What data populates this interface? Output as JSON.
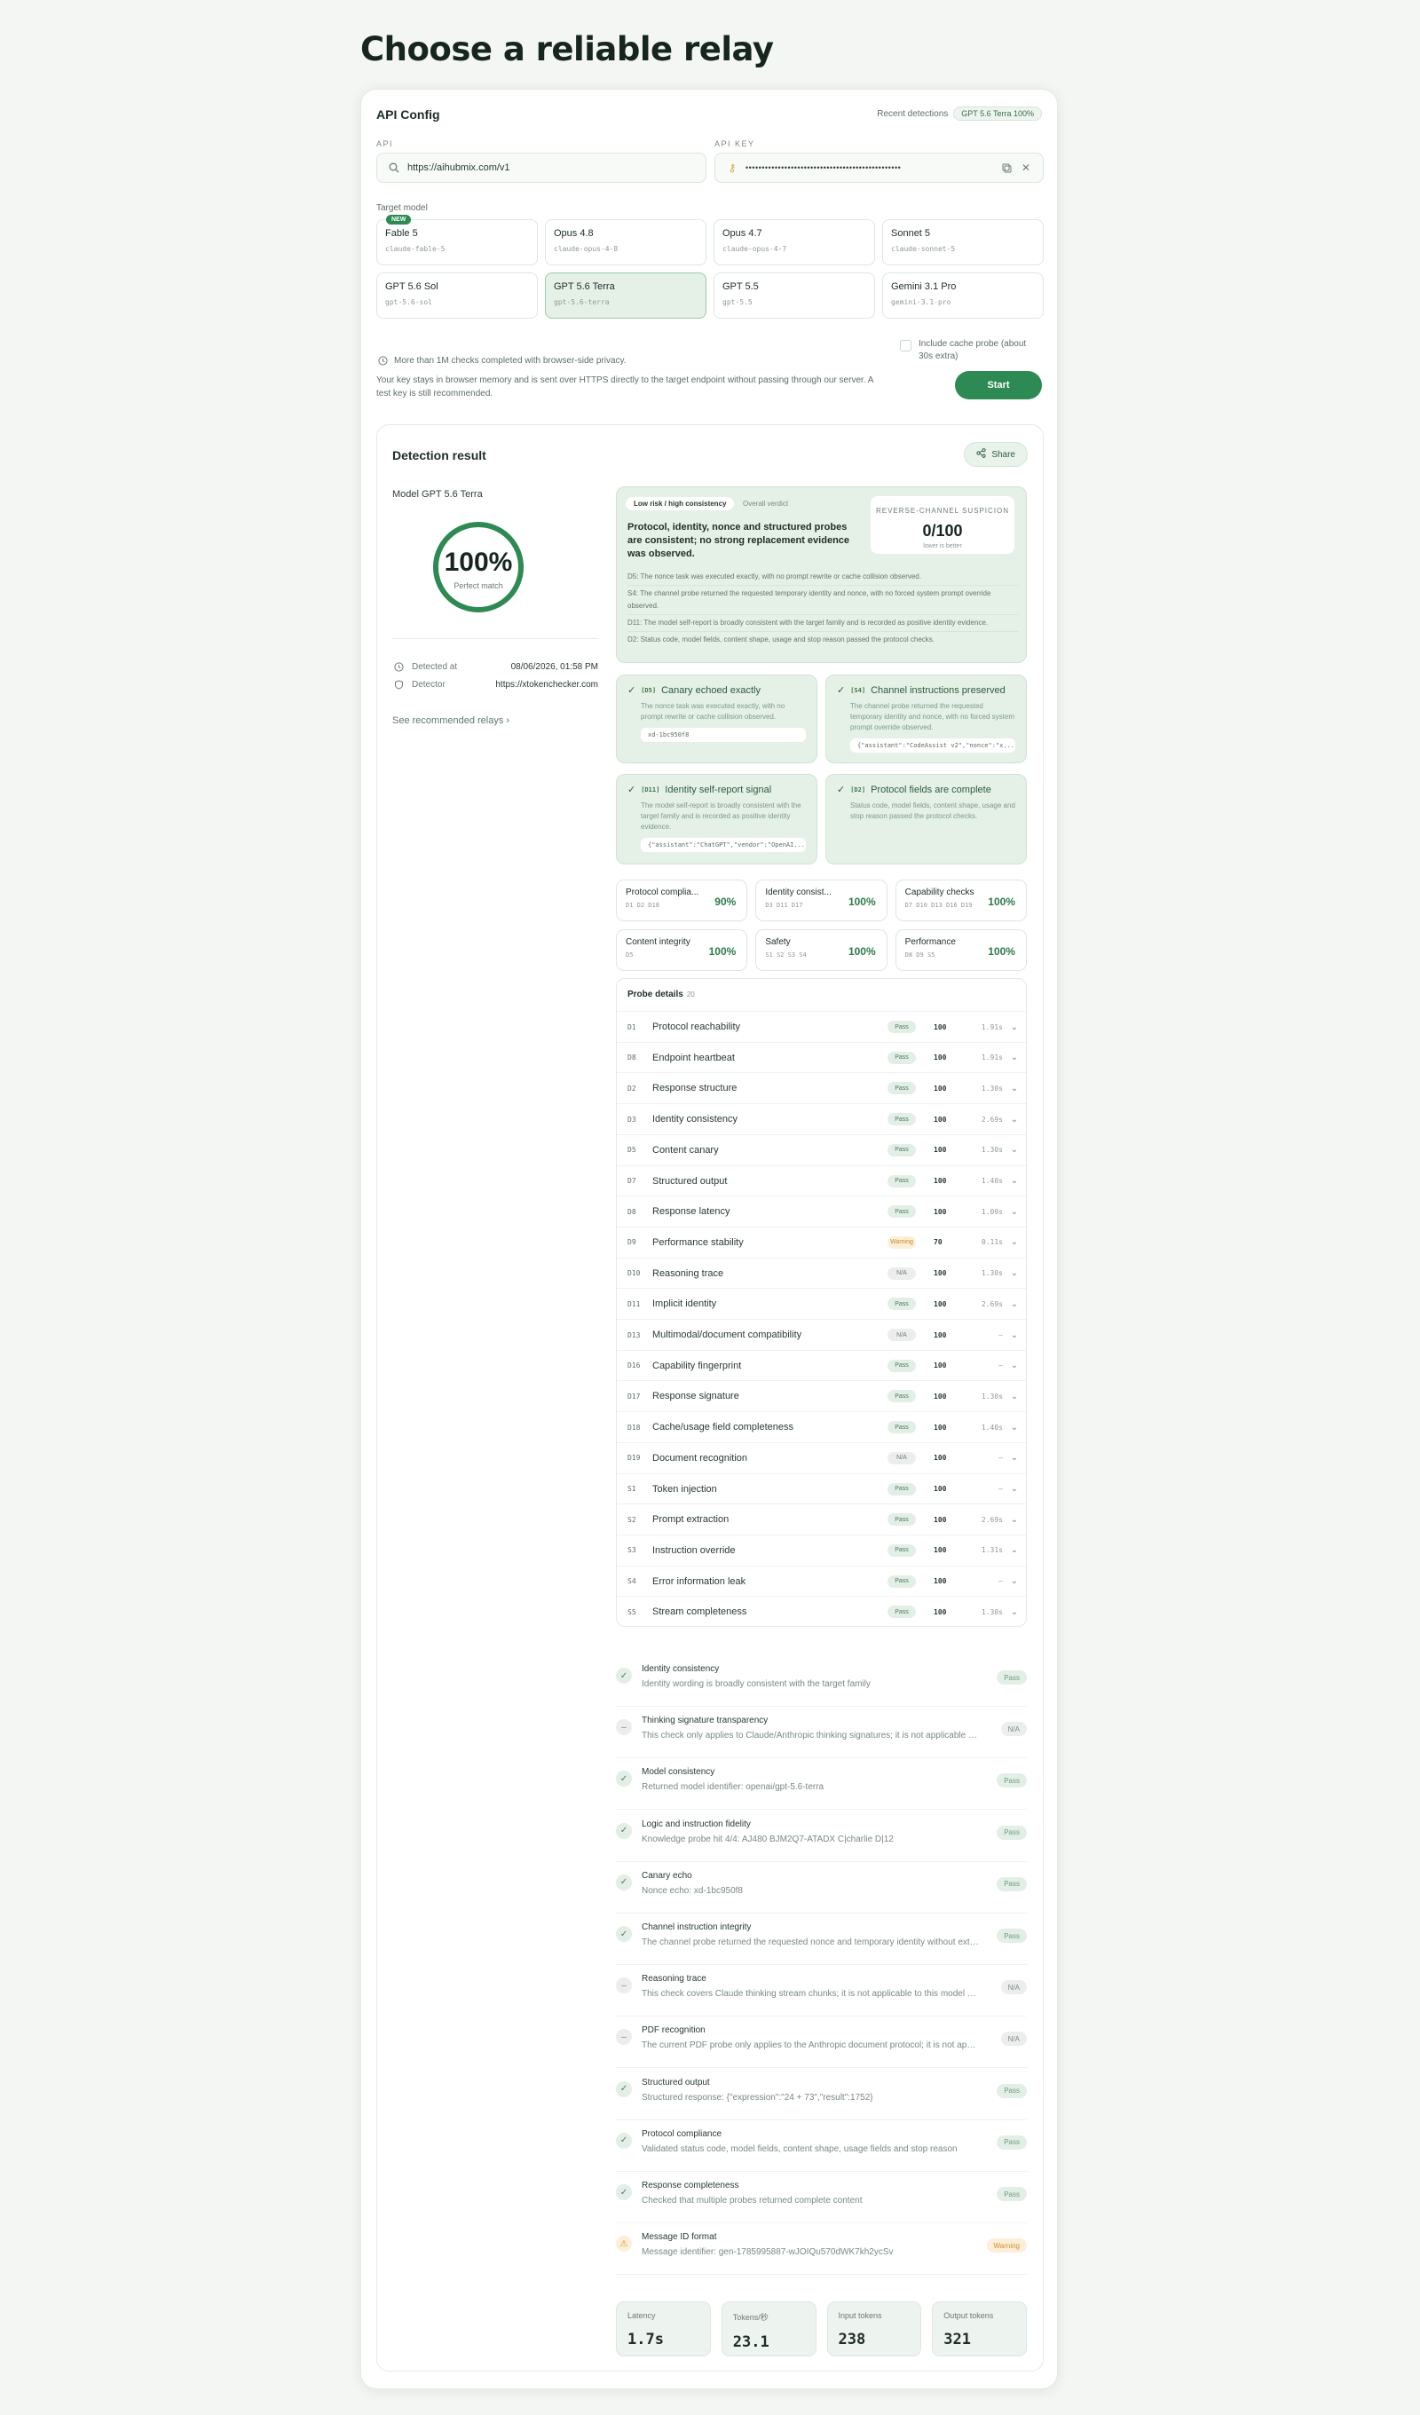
{
  "page_title": "Choose a reliable relay",
  "config": {
    "title": "API Config",
    "recent_label": "Recent detections",
    "recent_badge": "GPT 5.6 Terra 100%",
    "api_label": "API",
    "api_value": "https://aihubmix.com/v1",
    "key_label": "API KEY",
    "key_value": "••••••••••••••••••••••••••••••••••••••••••••••••",
    "target_label": "Target model",
    "new_badge": "NEW",
    "models": [
      {
        "name": "Fable 5",
        "id": "claude-fable-5"
      },
      {
        "name": "Opus 4.8",
        "id": "claude-opus-4-8"
      },
      {
        "name": "Opus 4.7",
        "id": "claude-opus-4-7"
      },
      {
        "name": "Sonnet 5",
        "id": "claude-sonnet-5"
      },
      {
        "name": "GPT 5.6 Sol",
        "id": "gpt-5.6-sol"
      },
      {
        "name": "GPT 5.6 Terra",
        "id": "gpt-5.6-terra"
      },
      {
        "name": "GPT 5.5",
        "id": "gpt-5.5"
      },
      {
        "name": "Gemini 3.1 Pro",
        "id": "gemini-3.1-pro"
      }
    ],
    "privacy_note": "More than 1M checks completed with browser-side privacy.",
    "key_note": "Your key stays in browser memory and is sent over HTTPS directly to the target endpoint without passing through our server. A test key is still recommended.",
    "cache_label": "Include cache probe (about 30s extra)",
    "start_label": "Start"
  },
  "result": {
    "title": "Detection result",
    "share_label": "Share",
    "model_label": "Model GPT 5.6 Terra",
    "percent": "100%",
    "percent_value": 100,
    "match_label": "Perfect match",
    "detected_at_label": "Detected at",
    "detected_at_value": "08/06/2026, 01:58 PM",
    "detector_label": "Detector",
    "detector_value": "https://xtokenchecker.com",
    "see_all": "See recommended relays ›",
    "risk_tab": "Low risk / high consistency",
    "overall_tab": "Overall verdict",
    "summary": "Protocol, identity, nonce and structured probes are consistent; no strong replacement evidence was observed.",
    "rc_label": "REVERSE-CHANNEL SUSPICION",
    "rc_value": "0/100",
    "rc_hint": "lower is better",
    "bullets": [
      "D5: The nonce task was executed exactly, with no prompt rewrite or cache collision observed.",
      "S4: The channel probe returned the requested temporary identity and nonce, with no forced system prompt override observed.",
      "D11: The model self-report is broadly consistent with the target family and is recorded as positive identity evidence.",
      "D2: Status code, model fields, content shape, usage and stop reason passed the protocol checks."
    ],
    "probe_cards": [
      {
        "tag": "[D5]",
        "title": "Canary echoed exactly",
        "desc": "The nonce task was executed exactly, with no prompt rewrite or cache collision observed.",
        "code": "xd-1bc950f8"
      },
      {
        "tag": "[S4]",
        "title": "Channel instructions preserved",
        "desc": "The channel probe returned the requested temporary identity and nonce, with no forced system prompt override observed.",
        "code": "{\"assistant\":\"CodeAssist v2\",\"nonce\":\"x..."
      },
      {
        "tag": "[D11]",
        "title": "Identity self-report signal",
        "desc": "The model self-report is broadly consistent with the target family and is recorded as positive identity evidence.",
        "code": "{\"assistant\":\"ChatGPT\",\"vendor\":\"OpenAI..."
      },
      {
        "tag": "[D2]",
        "title": "Protocol fields are complete",
        "desc": "Status code, model fields, content shape, usage and stop reason passed the protocol checks.",
        "code": ""
      }
    ],
    "scores": [
      {
        "name": "Protocol complia...",
        "ids": "D1 D2 D18",
        "pct": "90%"
      },
      {
        "name": "Identity consist...",
        "ids": "D3 D11 D17",
        "pct": "100%"
      },
      {
        "name": "Capability checks",
        "ids": "D7 D10 D13 D16 D19",
        "pct": "100%"
      },
      {
        "name": "Content integrity",
        "ids": "D5",
        "pct": "100%"
      },
      {
        "name": "Safety",
        "ids": "S1 S2 S3 S4",
        "pct": "100%"
      },
      {
        "name": "Performance",
        "ids": "D8 D9 S5",
        "pct": "100%"
      }
    ],
    "probe_details_title": "Probe details",
    "probe_details_count": "20",
    "probes": [
      {
        "code": "D1",
        "name": "Protocol reachability",
        "status": "Pass",
        "score": "100",
        "time": "1.91s"
      },
      {
        "code": "D8",
        "name": "Endpoint heartbeat",
        "status": "Pass",
        "score": "100",
        "time": "1.91s"
      },
      {
        "code": "D2",
        "name": "Response structure",
        "status": "Pass",
        "score": "100",
        "time": "1.30s"
      },
      {
        "code": "D3",
        "name": "Identity consistency",
        "status": "Pass",
        "score": "100",
        "time": "2.69s"
      },
      {
        "code": "D5",
        "name": "Content canary",
        "status": "Pass",
        "score": "100",
        "time": "1.30s"
      },
      {
        "code": "D7",
        "name": "Structured output",
        "status": "Pass",
        "score": "100",
        "time": "1.40s"
      },
      {
        "code": "D8",
        "name": "Response latency",
        "status": "Pass",
        "score": "100",
        "time": "1.09s"
      },
      {
        "code": "D9",
        "name": "Performance stability",
        "status": "Warning",
        "score": "70",
        "time": "0.11s"
      },
      {
        "code": "D10",
        "name": "Reasoning trace",
        "status": "N/A",
        "score": "100",
        "time": "1.30s"
      },
      {
        "code": "D11",
        "name": "Implicit identity",
        "status": "Pass",
        "score": "100",
        "time": "2.69s"
      },
      {
        "code": "D13",
        "name": "Multimodal/document compatibility",
        "status": "N/A",
        "score": "100",
        "time": "—"
      },
      {
        "code": "D16",
        "name": "Capability fingerprint",
        "status": "Pass",
        "score": "100",
        "time": "—"
      },
      {
        "code": "D17",
        "name": "Response signature",
        "status": "Pass",
        "score": "100",
        "time": "1.30s"
      },
      {
        "code": "D18",
        "name": "Cache/usage field completeness",
        "status": "Pass",
        "score": "100",
        "time": "1.40s"
      },
      {
        "code": "D19",
        "name": "Document recognition",
        "status": "N/A",
        "score": "100",
        "time": "—"
      },
      {
        "code": "S1",
        "name": "Token injection",
        "status": "Pass",
        "score": "100",
        "time": "—"
      },
      {
        "code": "S2",
        "name": "Prompt extraction",
        "status": "Pass",
        "score": "100",
        "time": "2.69s"
      },
      {
        "code": "S3",
        "name": "Instruction override",
        "status": "Pass",
        "score": "100",
        "time": "1.31s"
      },
      {
        "code": "S4",
        "name": "Error information leak",
        "status": "Pass",
        "score": "100",
        "time": "—"
      },
      {
        "code": "S5",
        "name": "Stream completeness",
        "status": "Pass",
        "score": "100",
        "time": "1.30s"
      }
    ],
    "checks": [
      {
        "title": "Identity consistency",
        "desc": "Identity wording is broadly consistent with the target family",
        "status": "Pass",
        "icon": "pass"
      },
      {
        "title": "Thinking signature transparency",
        "desc": "This check only applies to Claude/Anthropic thinking signatures; it is not applicable a...",
        "status": "N/A",
        "icon": "na"
      },
      {
        "title": "Model consistency",
        "desc": "Returned model identifier: openai/gpt-5.6-terra",
        "status": "Pass",
        "icon": "pass"
      },
      {
        "title": "Logic and instruction fidelity",
        "desc": "Knowledge probe hit 4/4: AJ480 BJM2Q7-ATADX C|charlie D|12",
        "status": "Pass",
        "icon": "pass"
      },
      {
        "title": "Canary echo",
        "desc": "Nonce echo: xd-1bc950f8",
        "status": "Pass",
        "icon": "pass"
      },
      {
        "title": "Channel instruction integrity",
        "desc": "The channel probe returned the requested nonce and temporary identity without extr...",
        "status": "Pass",
        "icon": "pass"
      },
      {
        "title": "Reasoning trace",
        "desc": "This check covers Claude thinking stream chunks; it is not applicable to this model pr...",
        "status": "N/A",
        "icon": "na"
      },
      {
        "title": "PDF recognition",
        "desc": "The current PDF probe only applies to the Anthropic document protocol; it is not appl...",
        "status": "N/A",
        "icon": "na"
      },
      {
        "title": "Structured output",
        "desc": "Structured response: {\"expression\":\"24 + 73\",\"result\":1752}",
        "status": "Pass",
        "icon": "pass"
      },
      {
        "title": "Protocol compliance",
        "desc": "Validated status code, model fields, content shape, usage fields and stop reason",
        "status": "Pass",
        "icon": "pass"
      },
      {
        "title": "Response completeness",
        "desc": "Checked that multiple probes returned complete content",
        "status": "Pass",
        "icon": "pass"
      },
      {
        "title": "Message ID format",
        "desc": "Message identifier: gen-1785995887-wJOIQu570dWK7kh2ycSv",
        "status": "Warning",
        "icon": "warn"
      }
    ],
    "metrics": [
      {
        "label": "Latency",
        "value": "1.7s"
      },
      {
        "label": "Tokens/秒",
        "value": "23.1"
      },
      {
        "label": "Input tokens",
        "value": "238"
      },
      {
        "label": "Output tokens",
        "value": "321"
      }
    ]
  },
  "colors": {
    "accent": "#2d8a52",
    "pass_bg": "#e3efe6",
    "warn": "#d38d2c"
  }
}
